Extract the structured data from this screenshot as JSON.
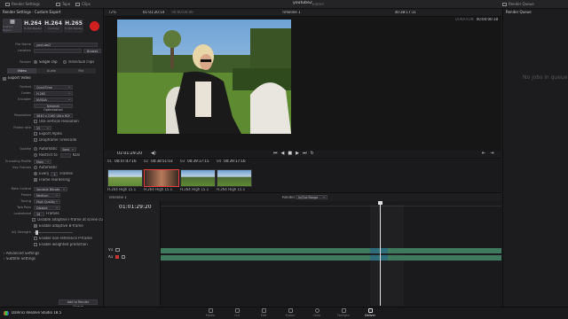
{
  "topbar": {
    "render_settings": "Render Settings",
    "tape": "Tape",
    "clips": "Clips",
    "project": "youtube2",
    "edited": "Edited",
    "render_queue": "Render Queue"
  },
  "left": {
    "title": "Render Settings - Custom Export",
    "codecs": [
      {
        "big": "",
        "sm": "Custom Export"
      },
      {
        "big": "H.264",
        "sm": "H.264 Master"
      },
      {
        "big": "H.264",
        "sm": "YouTube"
      },
      {
        "big": "H.265",
        "sm": "H.265 Master"
      }
    ],
    "file_name_label": "File Name",
    "file_name_value": "youtube2",
    "location_label": "Location",
    "location_value": "",
    "browse": "Browse",
    "render_label": "Render",
    "single_clip": "Single clip",
    "individual_clips": "Individual clips",
    "tabs": [
      "Video",
      "Audio",
      "File"
    ],
    "export_video": "Export Video",
    "format_label": "Format",
    "format_value": "QuickTime",
    "codec_label": "Codec",
    "codec_value": "H.265",
    "encoder_label": "Encoder",
    "encoder_value": "NVIDIA",
    "network_opt": "Network Optimization",
    "resolution_label": "Resolution",
    "resolution_value": "3840 x 2160 Ultra HD",
    "vertical_res": "Use vertical resolution",
    "frame_rate_label": "Frame rate",
    "frame_rate_value": "25",
    "export_alpha": "Export Alpha",
    "dropframe": "Dropframe Timecode",
    "quality_label": "Quality",
    "quality_auto": "Automatic",
    "quality_best": "Best",
    "restrict_to": "Restrict to",
    "kbs": "Kb/s",
    "encoding_profile_label": "Encoding Profile",
    "encoding_profile_value": "Main",
    "key_frames_label": "Key Frames",
    "key_frames_auto": "Automatic",
    "every": "Every",
    "every_value": "1",
    "frames": "Frames",
    "frame_reorder": "Frame reordering",
    "rate_control_label": "Rate Control",
    "rate_control_value": "Variable Bitrate",
    "preset_label": "Preset",
    "preset_value": "Medium",
    "tuning_label": "Tuning",
    "tuning_value": "High Quality",
    "two_pass_label": "Two Pass",
    "two_pass_value": "Disable",
    "lookahead_label": "Lookahead",
    "lookahead_value": "16",
    "frames2": "Frames",
    "disable_adaptive": "Disable adaptive I-frame at scene cuts",
    "enable_adaptive_b": "Enable adaptive B-frame",
    "aq_strength_label": "AQ Strength",
    "enable_non_ref": "Enable non-reference P-frame",
    "enable_weighted": "Enable weighted prediction",
    "advanced": "Advanced Settings",
    "subtitle": "Subtitle Settings",
    "add_queue": "Add to Render Queue"
  },
  "viewer": {
    "zoom": "72%",
    "timecode_left": "01:01:20:14",
    "timecode_left2": "00:00:00:00",
    "timeline_name": "Timeline 1",
    "timecode_right": "00:38:17:11",
    "duration_label": "DURATION",
    "duration_value": "00:00:00:18",
    "current_tc": "01:01:29:20"
  },
  "queue": {
    "empty": "No jobs in queue"
  },
  "clips": [
    {
      "num": "01",
      "tc": "00:47:47:16",
      "label": "H.264 High L5.1"
    },
    {
      "num": "02",
      "tc": "00:38:51:03",
      "label": "H.264 High L5.1"
    },
    {
      "num": "03",
      "tc": "00:39:17:15",
      "label": "H.264 High L5.1"
    },
    {
      "num": "04",
      "tc": "00:39:17:16",
      "label": "H.264 High L5.1"
    }
  ],
  "timeline": {
    "label": "Timeline 1",
    "render_label": "Render",
    "render_value": "In/Out Range",
    "timecode": "01:01:29:20",
    "tracks": [
      {
        "id": "V1"
      },
      {
        "id": "A1"
      }
    ]
  },
  "app": {
    "name": "DaVinci Resolve Studio 18.5"
  },
  "pages": [
    "Media",
    "Cut",
    "Edit",
    "Fusion",
    "Color",
    "Fairlight",
    "Deliver"
  ],
  "colors": {
    "accent": "#d21f1f",
    "clip_green": "#3f7a5f",
    "clip_teal": "#2f6d7b",
    "playhead": "#e0e0e0"
  }
}
